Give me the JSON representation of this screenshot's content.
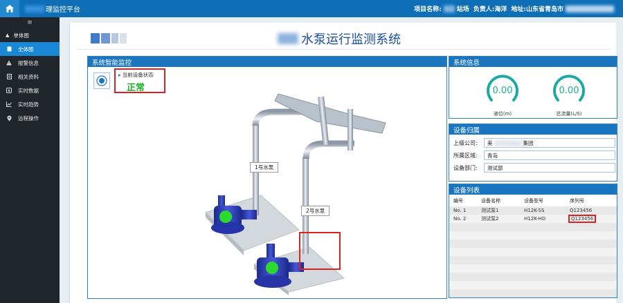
{
  "topbar": {
    "brand_visible": "理监控平台",
    "project_label": "项目名称:",
    "project_suffix": "站场",
    "owner_label": "负责人:",
    "owner_name": "海洋",
    "address_label": "地址:",
    "address_value": "山东省青岛市"
  },
  "sidebar": {
    "toggle": "≡",
    "items": [
      {
        "label": "单体图",
        "icon": "chevron-up-icon",
        "active": false
      },
      {
        "label": "全体图",
        "icon": "document-icon",
        "active": true
      },
      {
        "label": "报警信息",
        "icon": "warning-icon",
        "active": false
      },
      {
        "label": "相关资料",
        "icon": "file-text-icon",
        "active": false
      },
      {
        "label": "实时数据",
        "icon": "download-icon",
        "active": false
      },
      {
        "label": "实时趋势",
        "icon": "line-chart-icon",
        "active": false
      },
      {
        "label": "远程操作",
        "icon": "location-icon",
        "active": false
      }
    ]
  },
  "page": {
    "title_visible": "水泵运行监测系统"
  },
  "monitor": {
    "title": "系统智能监控",
    "status_label": "当前设备状态",
    "status_value": "正常",
    "pump1_tag": "1号水泵",
    "pump2_tag": "2号水泵",
    "status_color": "#22cc33"
  },
  "sysinfo": {
    "title": "系统信息",
    "gauges": [
      {
        "value": "0.00",
        "label": "液位(m)"
      },
      {
        "value": "0.00",
        "label": "总流量(L/S)"
      }
    ],
    "gauge_color": "#1ba9a2"
  },
  "owner": {
    "title": "设备归属",
    "fields": [
      {
        "label": "上级公司:",
        "value_prefix": "美",
        "value_suffix": "集团"
      },
      {
        "label": "所属区域:",
        "value": "青岛"
      },
      {
        "label": "设备部门:",
        "value": "测试部"
      }
    ]
  },
  "devlist": {
    "title": "设备列表",
    "columns": [
      "编号",
      "设备名称",
      "设备型号",
      "序列号"
    ],
    "rows": [
      {
        "id": "No. 1",
        "name": "测试泵1",
        "model": "H12K-SS",
        "serial": "Q123456"
      },
      {
        "id": "No. 2",
        "name": "测试泵2",
        "model": "H12K-HD",
        "serial": "Q123456"
      }
    ]
  }
}
